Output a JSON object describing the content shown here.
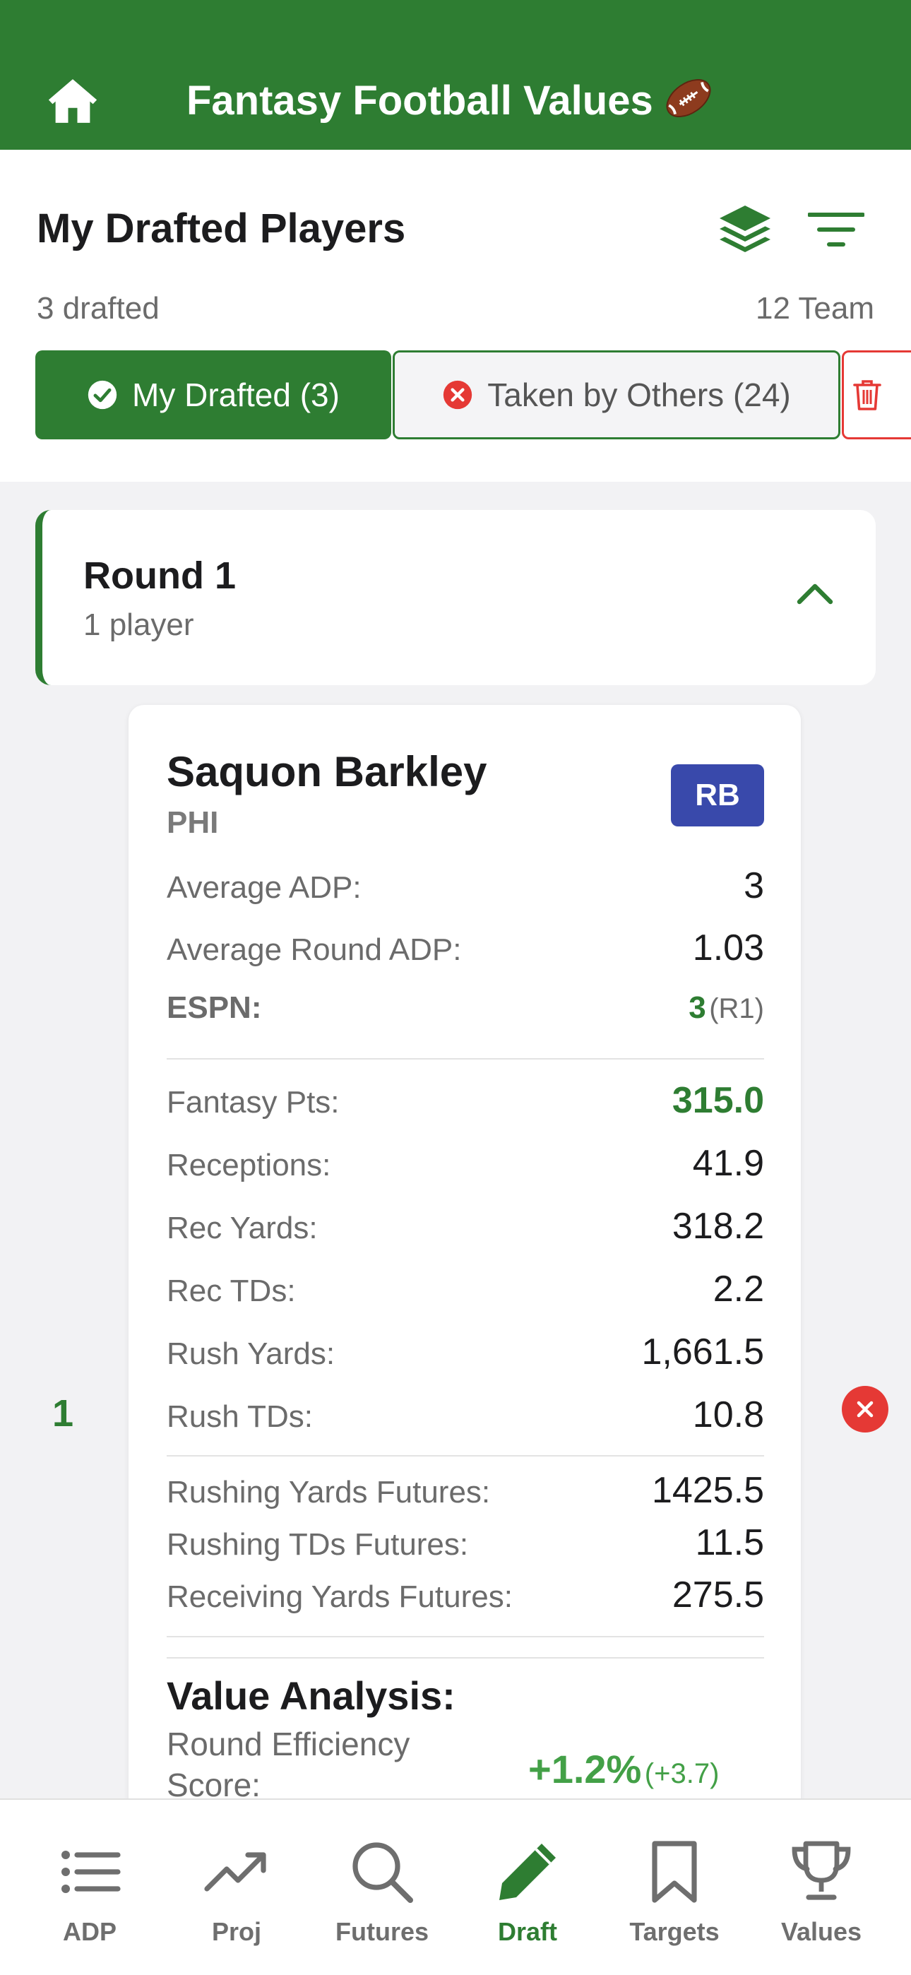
{
  "header": {
    "title": "Fantasy Football Values"
  },
  "page": {
    "title": "My Drafted Players",
    "drafted_count": "3 drafted",
    "team_size": "12 Team"
  },
  "tabs": {
    "mine": "My Drafted (3)",
    "others": "Taken by Others (24)"
  },
  "round": {
    "title": "Round 1",
    "subtitle": "1 player"
  },
  "pick": {
    "number": "1"
  },
  "player": {
    "name": "Saquon Barkley",
    "team": "PHI",
    "position": "RB",
    "adp": [
      {
        "label": "Average ADP:",
        "value": "3"
      },
      {
        "label": "Average Round ADP:",
        "value": "1.03"
      }
    ],
    "espn": {
      "label": "ESPN:",
      "rank": "3",
      "round": "(R1)"
    },
    "projections": [
      {
        "label": "Fantasy Pts:",
        "value": "315.0"
      },
      {
        "label": "Receptions:",
        "value": "41.9"
      },
      {
        "label": "Rec Yards:",
        "value": "318.2"
      },
      {
        "label": "Rec TDs:",
        "value": "2.2"
      },
      {
        "label": "Rush Yards:",
        "value": "1,661.5"
      },
      {
        "label": "Rush TDs:",
        "value": "10.8"
      }
    ],
    "futures": [
      {
        "label": "Rushing Yards Futures:",
        "value": "1425.5"
      },
      {
        "label": "Rushing TDs Futures:",
        "value": "11.5"
      },
      {
        "label": "Receiving Yards Futures:",
        "value": "275.5"
      }
    ],
    "value_analysis": {
      "title": "Value Analysis:",
      "efficiency_label": "Round Efficiency Score:",
      "efficiency_pct": "+1.2%",
      "efficiency_pts": "(+3.7)"
    }
  },
  "nav": [
    {
      "label": "ADP",
      "icon": "list-icon"
    },
    {
      "label": "Proj",
      "icon": "trend-icon"
    },
    {
      "label": "Futures",
      "icon": "search-icon"
    },
    {
      "label": "Draft",
      "icon": "pencil-icon"
    },
    {
      "label": "Targets",
      "icon": "bookmark-icon"
    },
    {
      "label": "Values",
      "icon": "trophy-icon"
    }
  ],
  "colors": {
    "primary": "#2e7d32",
    "badge": "#3949ab",
    "danger": "#e53935",
    "positive": "#43a047"
  }
}
